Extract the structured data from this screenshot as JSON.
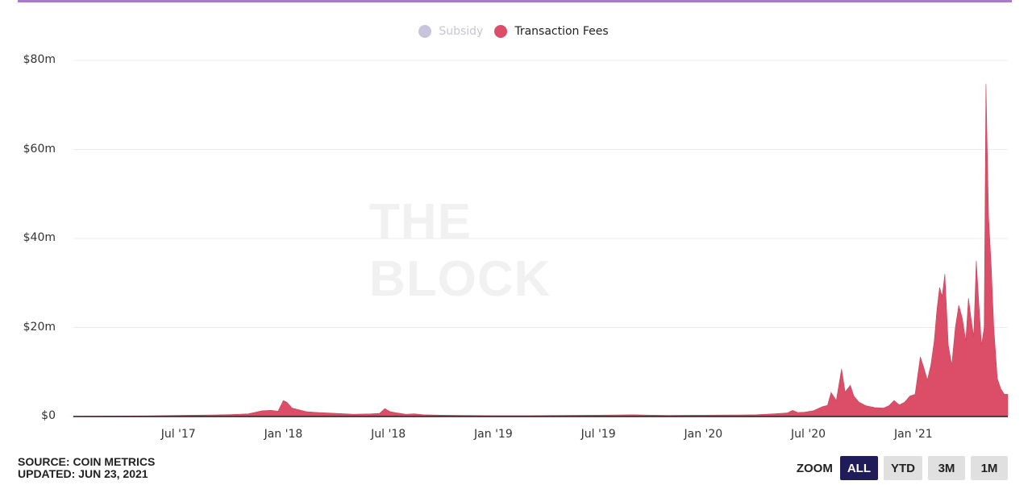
{
  "header": {
    "accent_color": "#a77bc9"
  },
  "watermark": "THE BLOCK",
  "legend": [
    {
      "label": "Subsidy",
      "color": "#c7c5da",
      "active": false
    },
    {
      "label": "Transaction Fees",
      "color": "#dc4d68",
      "active": true
    }
  ],
  "footer": {
    "source": "SOURCE: COIN METRICS",
    "updated": "UPDATED: JUN 23, 2021"
  },
  "zoom": {
    "label": "ZOOM",
    "buttons": [
      {
        "label": "ALL",
        "active": true
      },
      {
        "label": "YTD",
        "active": false
      },
      {
        "label": "3M",
        "active": false
      },
      {
        "label": "1M",
        "active": false
      }
    ]
  },
  "chart_data": {
    "type": "area",
    "title": "",
    "xlabel": "",
    "ylabel": "",
    "x_unit": "months since Jan 2017",
    "xlim": [
      0,
      53.4
    ],
    "ylim": [
      0,
      80
    ],
    "y_ticks": [
      {
        "value": 0,
        "label": "$0"
      },
      {
        "value": 20,
        "label": "$20m"
      },
      {
        "value": 40,
        "label": "$40m"
      },
      {
        "value": 60,
        "label": "$60m"
      },
      {
        "value": 80,
        "label": "$80m"
      }
    ],
    "x_ticks": [
      {
        "value": 6,
        "label": "Jul '17"
      },
      {
        "value": 12,
        "label": "Jan '18"
      },
      {
        "value": 18,
        "label": "Jul '18"
      },
      {
        "value": 24,
        "label": "Jan '19"
      },
      {
        "value": 30,
        "label": "Jul '19"
      },
      {
        "value": 36,
        "label": "Jan '20"
      },
      {
        "value": 42,
        "label": "Jul '20"
      },
      {
        "value": 48,
        "label": "Jan '21"
      }
    ],
    "grid": true,
    "legend_position": "top-center",
    "series": [
      {
        "name": "Subsidy",
        "visible": false,
        "color": "#c7c5da",
        "x": [],
        "values": []
      },
      {
        "name": "Transaction Fees",
        "visible": true,
        "color": "#dc4d68",
        "x": [
          0,
          2,
          4,
          5,
          6,
          7,
          8,
          9,
          10,
          10.8,
          11.3,
          11.7,
          12.0,
          12.2,
          12.5,
          12.9,
          13.3,
          14,
          15,
          16,
          17,
          17.5,
          17.8,
          18.1,
          18.5,
          19,
          19.5,
          20,
          21,
          22,
          24,
          26,
          28,
          30,
          31,
          32,
          33,
          34,
          36,
          38,
          39,
          40,
          40.8,
          41.1,
          41.4,
          41.8,
          42.3,
          42.8,
          43.1,
          43.3,
          43.6,
          43.9,
          44.1,
          44.4,
          44.6,
          44.9,
          45.3,
          45.8,
          46.3,
          46.6,
          46.9,
          47.2,
          47.5,
          47.8,
          48.1,
          48.4,
          48.6,
          48.8,
          49.0,
          49.2,
          49.35,
          49.5,
          49.65,
          49.8,
          50.0,
          50.2,
          50.4,
          50.6,
          50.8,
          51.0,
          51.15,
          51.3,
          51.45,
          51.6,
          51.75,
          51.9,
          52.05,
          52.15,
          52.3,
          52.45,
          52.6,
          52.8,
          53.0,
          53.2,
          53.4
        ],
        "values": [
          0.05,
          0.1,
          0.15,
          0.2,
          0.25,
          0.3,
          0.35,
          0.45,
          0.6,
          1.3,
          1.4,
          1.2,
          3.6,
          3.2,
          1.9,
          1.5,
          1.1,
          0.9,
          0.7,
          0.5,
          0.6,
          0.7,
          1.8,
          1.1,
          0.8,
          0.5,
          0.6,
          0.4,
          0.3,
          0.25,
          0.2,
          0.2,
          0.25,
          0.3,
          0.35,
          0.4,
          0.3,
          0.25,
          0.3,
          0.35,
          0.4,
          0.6,
          0.8,
          1.4,
          0.9,
          1.0,
          1.3,
          2.2,
          2.5,
          5.4,
          3.6,
          10.7,
          5.5,
          7.0,
          4.6,
          3.2,
          2.4,
          2.0,
          1.9,
          2.4,
          3.6,
          2.6,
          3.2,
          4.6,
          5.0,
          13.4,
          11.0,
          8.2,
          11.5,
          17.0,
          24.0,
          29.0,
          27.0,
          32.0,
          16.0,
          11.6,
          20.0,
          25.0,
          22.0,
          17.0,
          26.6,
          22.0,
          18.0,
          35.0,
          25.0,
          16.0,
          20.0,
          74.7,
          45.0,
          33.8,
          20.0,
          8.5,
          6.2,
          5.0,
          5.0
        ]
      }
    ]
  }
}
